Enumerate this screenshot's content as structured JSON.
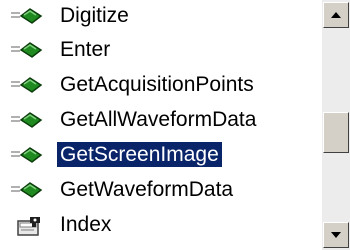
{
  "list": {
    "items": [
      {
        "label": "Digitize",
        "icon": "method-icon",
        "selected": false
      },
      {
        "label": "Enter",
        "icon": "method-icon",
        "selected": false
      },
      {
        "label": "GetAcquisitionPoints",
        "icon": "method-icon",
        "selected": false
      },
      {
        "label": "GetAllWaveformData",
        "icon": "method-icon",
        "selected": false
      },
      {
        "label": "GetScreenImage",
        "icon": "method-icon",
        "selected": true
      },
      {
        "label": "GetWaveformData",
        "icon": "method-icon",
        "selected": false
      },
      {
        "label": "Index",
        "icon": "property-icon",
        "selected": false
      }
    ]
  },
  "scrollbar": {
    "position_fraction": 0.55
  },
  "colors": {
    "selection": "#0a246a",
    "method_green": "#1f8a1f"
  }
}
